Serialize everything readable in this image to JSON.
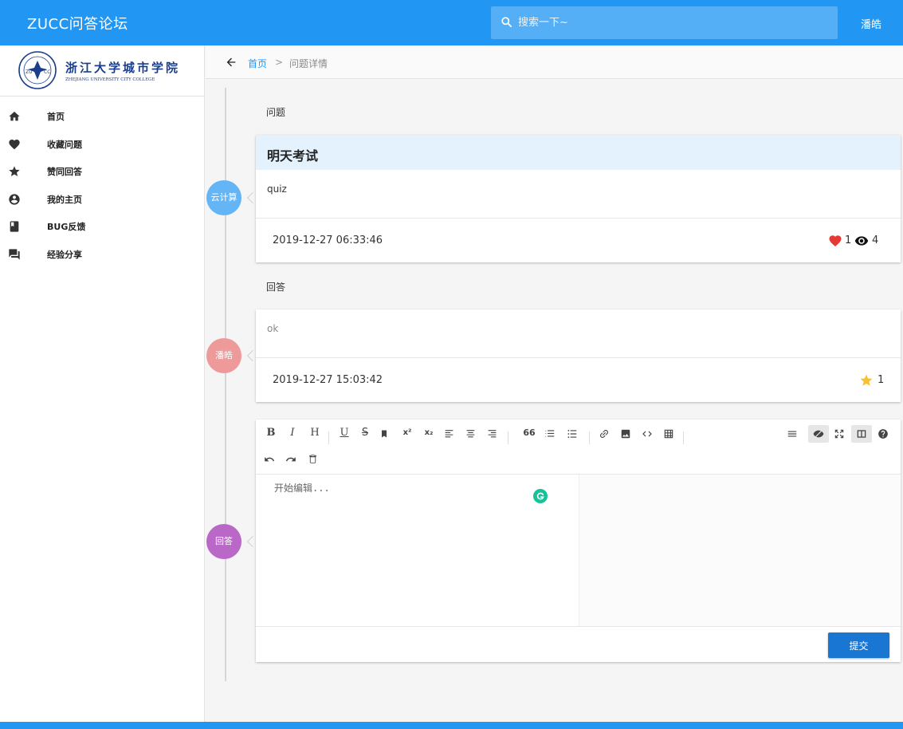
{
  "header": {
    "app_title": "ZUCC问答论坛",
    "search_placeholder": "搜索一下~",
    "user_name": "潘皓"
  },
  "logo": {
    "name": "浙江大学城市学院",
    "subtitle": "ZHEJIANG UNIVERSITY CITY COLLEGE",
    "seal_text": "ZU CC"
  },
  "sidebar": {
    "items": [
      {
        "label": "首页",
        "icon": "home-icon"
      },
      {
        "label": "收藏问题",
        "icon": "heart-icon"
      },
      {
        "label": "赞同回答",
        "icon": "star-icon"
      },
      {
        "label": "我的主页",
        "icon": "account-circle-icon"
      },
      {
        "label": "BUG反馈",
        "icon": "book-icon"
      },
      {
        "label": "经验分享",
        "icon": "forum-icon"
      }
    ]
  },
  "breadcrumb": {
    "home": "首页",
    "separator": ">",
    "current": "问题详情"
  },
  "question": {
    "section_label": "问题",
    "tag": "云计算",
    "title": "明天考试",
    "body": "quiz",
    "date": "2019-12-27 06:33:46",
    "likes": "1",
    "views": "4"
  },
  "answer": {
    "section_label": "回答",
    "author": "潘皓",
    "body": "ok",
    "date": "2019-12-27 15:03:42",
    "stars": "1"
  },
  "editor": {
    "badge": "回答",
    "placeholder": "开始编辑...",
    "submit_label": "提交",
    "toolbar_text": {
      "bold": "B",
      "italic": "I",
      "heading": "H",
      "underline": "U",
      "strike": "S",
      "superscript": "x²",
      "subscript": "x₂",
      "quote": "66"
    }
  },
  "colors": {
    "primary": "#2196f3",
    "question_header": "#e3f2fd",
    "tag_blue": "#64b5f6",
    "tag_red": "#ef9a9a",
    "tag_purple": "#ba68c8",
    "submit": "#1976d2",
    "like": "#e53935",
    "star": "#fbc02d"
  }
}
